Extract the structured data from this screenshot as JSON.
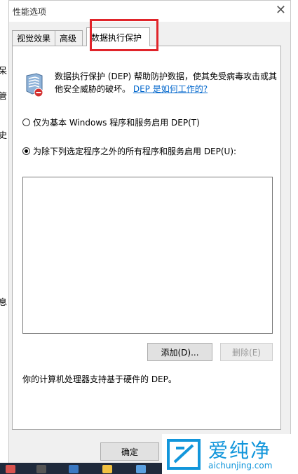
{
  "background": {
    "left_fragments": [
      "呆",
      "管",
      "史",
      "息"
    ]
  },
  "window": {
    "title": "性能选项",
    "close_symbol": "✕"
  },
  "tabs": [
    {
      "label": "视觉效果",
      "active": false
    },
    {
      "label": "高级",
      "active": false
    },
    {
      "label": "数据执行保护",
      "active": true
    }
  ],
  "panel": {
    "icon": "dep-shield-icon",
    "description": "数据执行保护 (DEP) 帮助防护数据，使其免受病毒攻击或其他安全威胁的破坏。",
    "help_link": "DEP 是如何工作的?",
    "option_basic": "仅为基本 Windows 程序和服务启用 DEP(T)",
    "option_all_except": "为除下列选定程序之外的所有程序和服务启用 DEP(U):",
    "selected_option": "all_except",
    "add_button": "添加(D)...",
    "delete_button": "删除(E)",
    "hardware_note": "你的计算机处理器支持基于硬件的 DEP。"
  },
  "footer": {
    "ok_button": "确定"
  },
  "watermark": {
    "name": "爱纯净",
    "url": "aichunjing.com",
    "color": "#1296db"
  },
  "colors": {
    "highlight_box": "#e0242a",
    "link": "#0066cc"
  }
}
